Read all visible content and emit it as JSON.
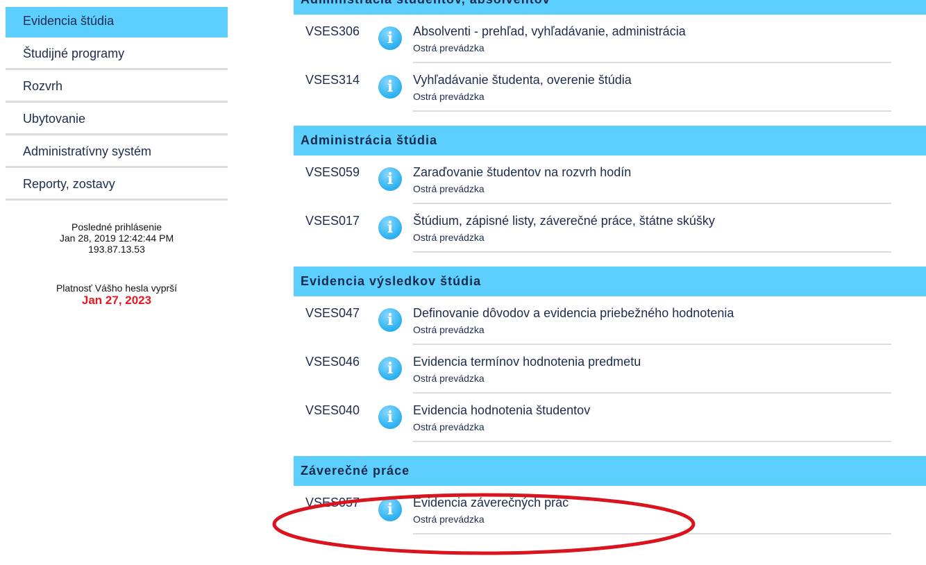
{
  "sidebar": {
    "items": [
      {
        "label": "Evidencia štúdia",
        "active": true
      },
      {
        "label": "Študijné programy"
      },
      {
        "label": "Rozvrh"
      },
      {
        "label": "Ubytovanie"
      },
      {
        "label": "Administratívny systém"
      },
      {
        "label": "Reporty, zostavy"
      }
    ],
    "last_login_label": "Posledné prihlásenie",
    "last_login_datetime": "Jan 28, 2019 12:42:44 PM",
    "last_login_ip": "193.87.13.53",
    "password_expiry_label": "Platnosť Vášho hesla vyprší",
    "password_expiry_date": "Jan 27, 2023"
  },
  "sections": [
    {
      "title": "Administrácia študentov, absolventov",
      "entries": [
        {
          "code": "VSES306",
          "title": "Absolventi - prehľad, vyhľadávanie, administrácia",
          "status": "Ostrá prevádzka"
        },
        {
          "code": "VSES314",
          "title": "Vyhľadávanie študenta, overenie štúdia",
          "status": "Ostrá prevádzka"
        }
      ]
    },
    {
      "title": "Administrácia štúdia",
      "entries": [
        {
          "code": "VSES059",
          "title": "Zaraďovanie študentov na rozvrh hodín",
          "status": "Ostrá prevádzka"
        },
        {
          "code": "VSES017",
          "title": "Štúdium, zápisné listy, záverečné práce, štátne skúšky",
          "status": "Ostrá prevádzka"
        }
      ]
    },
    {
      "title": "Evidencia výsledkov štúdia",
      "entries": [
        {
          "code": "VSES047",
          "title": "Definovanie dôvodov a evidencia priebežného hodnotenia",
          "status": "Ostrá prevádzka"
        },
        {
          "code": "VSES046",
          "title": "Evidencia termínov hodnotenia predmetu",
          "status": "Ostrá prevádzka"
        },
        {
          "code": "VSES040",
          "title": "Evidencia hodnotenia študentov",
          "status": "Ostrá prevádzka"
        }
      ]
    },
    {
      "title": "Záverečné práce",
      "entries": [
        {
          "code": "VSES057",
          "title": "Evidencia záverečných prác",
          "status": "Ostrá prevádzka"
        }
      ]
    }
  ],
  "icons": {
    "info": "info-icon"
  },
  "colors": {
    "accent": "#5ccfff",
    "expiry": "#e8181f",
    "annotation": "#d9141e"
  },
  "annotation": {
    "highlighted_code": "VSES057"
  }
}
